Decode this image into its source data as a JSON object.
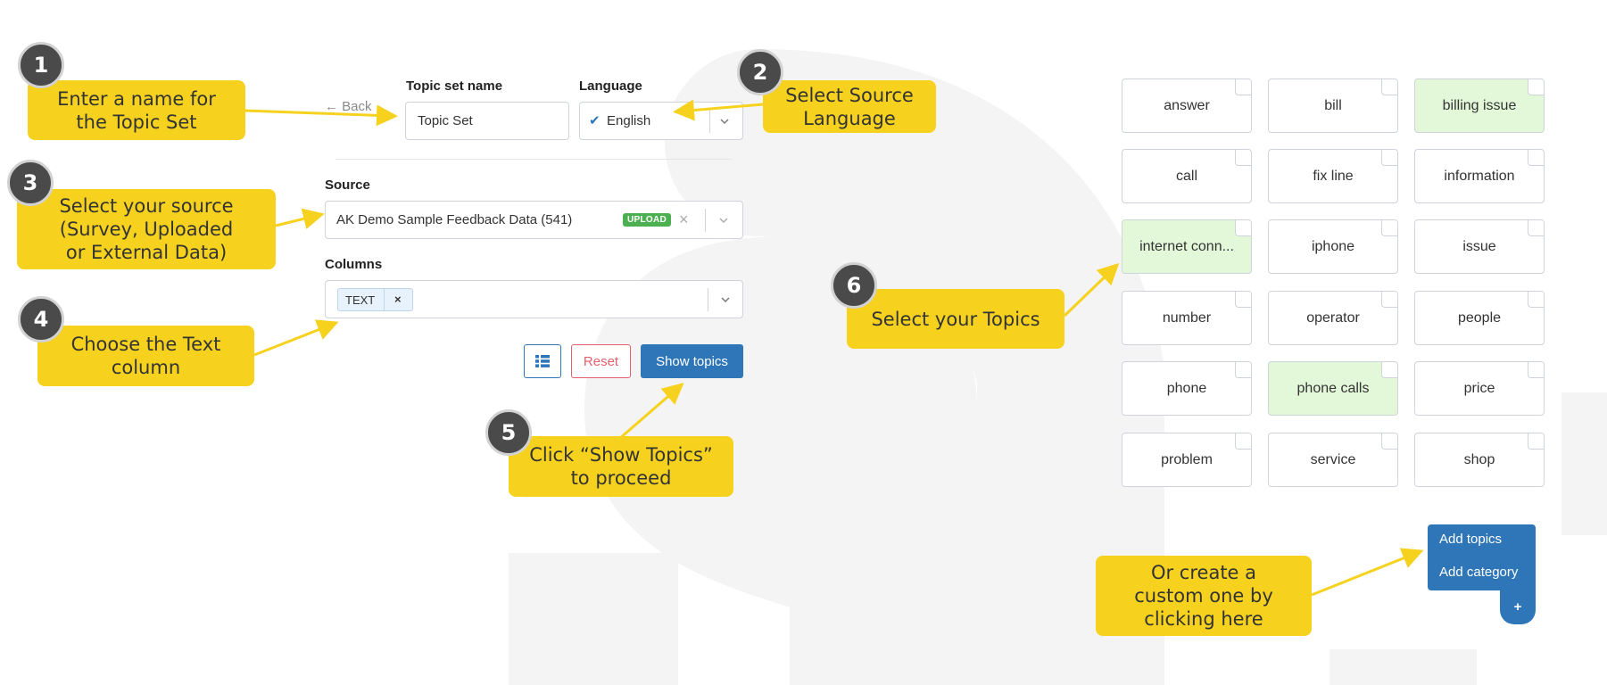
{
  "form": {
    "back_label": "Back",
    "topic_set_name_label": "Topic set name",
    "topic_set_name_value": "Topic Set",
    "language_label": "Language",
    "language_value": "English",
    "source_label": "Source",
    "source_value": "AK Demo Sample Feedback Data (541)",
    "source_badge": "UPLOAD",
    "columns_label": "Columns",
    "column_chip": "TEXT",
    "chip_remove": "×",
    "reset_label": "Reset",
    "show_topics_label": "Show topics"
  },
  "topics": [
    {
      "label": "answer",
      "selected": false
    },
    {
      "label": "bill",
      "selected": false
    },
    {
      "label": "billing issue",
      "selected": true
    },
    {
      "label": "call",
      "selected": false
    },
    {
      "label": "fix line",
      "selected": false
    },
    {
      "label": "information",
      "selected": false
    },
    {
      "label": "internet conn...",
      "selected": true
    },
    {
      "label": "iphone",
      "selected": false
    },
    {
      "label": "issue",
      "selected": false
    },
    {
      "label": "number",
      "selected": false
    },
    {
      "label": "operator",
      "selected": false
    },
    {
      "label": "people",
      "selected": false
    },
    {
      "label": "phone",
      "selected": false
    },
    {
      "label": "phone calls",
      "selected": true
    },
    {
      "label": "price",
      "selected": false
    },
    {
      "label": "problem",
      "selected": false
    },
    {
      "label": "service",
      "selected": false
    },
    {
      "label": "shop",
      "selected": false
    }
  ],
  "menu": {
    "add_topics": "Add topics",
    "add_category": "Add category",
    "plus": "+"
  },
  "callouts": {
    "c1_num": "1",
    "c1_line1": "Enter a name for",
    "c1_line2": "the Topic Set",
    "c2_num": "2",
    "c2_line1": "Select Source",
    "c2_line2": "Language",
    "c3_num": "3",
    "c3_line1": "Select your source",
    "c3_line2": "(Survey, Uploaded",
    "c3_line3": "or External Data)",
    "c4_num": "4",
    "c4_line1": "Choose the Text",
    "c4_line2": "column",
    "c5_num": "5",
    "c5_line1": "Click “Show Topics”",
    "c5_line2": "to proceed",
    "c6_num": "6",
    "c6_line1": "Select your Topics",
    "c7_line1": "Or create a",
    "c7_line2": "custom one by",
    "c7_line3": "clicking here"
  },
  "colors": {
    "callout": "#f6d21f",
    "primary": "#2f76b8",
    "selected_topic": "#e2f8d8",
    "reset": "#e4606d",
    "upload_badge": "#4caf50"
  }
}
